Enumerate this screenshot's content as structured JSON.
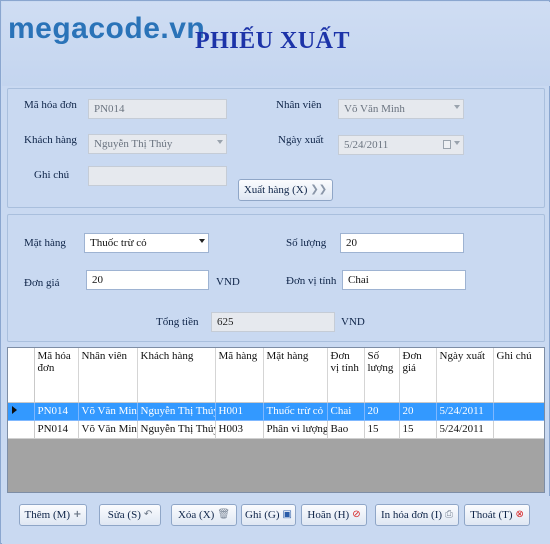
{
  "brand": {
    "watermark": "megacode.vn"
  },
  "title": "PHIẾU XUẤT",
  "invoice": {
    "ma_hoa_don_label": "Mã hóa đơn",
    "ma_hoa_don_value": "PN014",
    "nhan_vien_label": "Nhân viên",
    "nhan_vien_value": "Võ Văn Minh",
    "khach_hang_label": "Khách hàng",
    "khach_hang_value": "Nguyễn Thị Thúy",
    "ngay_xuat_label": "Ngày xuất",
    "ngay_xuat_value": "5/24/2011",
    "ghi_chu_label": "Ghi chú",
    "ghi_chu_value": "",
    "xuat_hang_button": "Xuất hàng (X)"
  },
  "item": {
    "mat_hang_label": "Mặt hàng",
    "mat_hang_value": "Thuốc trừ cỏ",
    "so_luong_label": "Số lượng",
    "so_luong_value": "20",
    "don_gia_label": "Đơn giá",
    "don_gia_value": "20",
    "don_gia_unit": "VND",
    "don_vi_tinh_label": "Đơn vị tính",
    "don_vi_tinh_value": "Chai",
    "tong_tien_label": "Tổng tiền",
    "tong_tien_value": "625",
    "tong_tien_unit": "VND"
  },
  "grid": {
    "columns": [
      "Mã hóa đơn",
      "Nhân viên",
      "Khách hàng",
      "Mã hàng",
      "Mặt hàng",
      "Đơn vị tính",
      "Số lượng",
      "Đơn giá",
      "Ngày xuất",
      "Ghi chú"
    ],
    "rows": [
      [
        "PN014",
        "Võ Văn Minh",
        "Nguyễn Thị Thúy",
        "H001",
        "Thuốc trừ cỏ",
        "Chai",
        "20",
        "20",
        "5/24/2011",
        ""
      ],
      [
        "PN014",
        "Võ Văn Minh",
        "Nguyễn Thị Thúy",
        "H003",
        "Phân vi lượng",
        "Bao",
        "15",
        "15",
        "5/24/2011",
        ""
      ]
    ],
    "selected_row": 0
  },
  "buttons": {
    "them": "Thêm (M)",
    "sua": "Sửa (S)",
    "xoa": "Xóa (X)",
    "ghi": "Ghi (G)",
    "hoan": "Hoãn (H)",
    "in_hoa_don": "In hóa đơn (I)",
    "thoat": "Thoát (T)"
  },
  "colors": {
    "title": "#1c33a8",
    "watermark": "#2a73b8",
    "selection": "#3399ff",
    "background": "#c9d9f1"
  }
}
